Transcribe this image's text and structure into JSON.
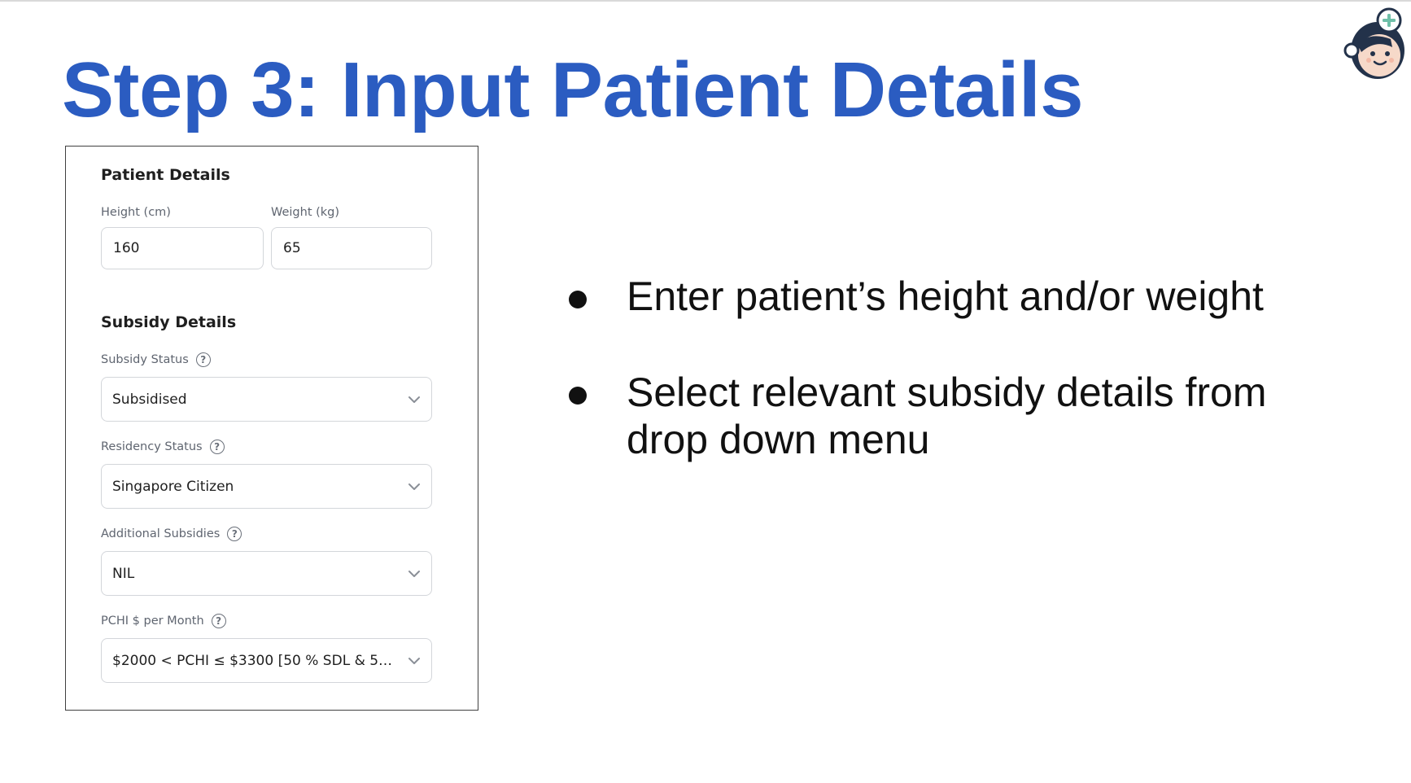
{
  "slide": {
    "title": "Step 3: Input Patient Details"
  },
  "form": {
    "patient_section_title": "Patient Details",
    "height": {
      "label": "Height (cm)",
      "value": "160"
    },
    "weight": {
      "label": "Weight (kg)",
      "value": "65"
    },
    "subsidy_section_title": "Subsidy Details",
    "subsidy_status": {
      "label": "Subsidy Status",
      "value": "Subsidised"
    },
    "residency_status": {
      "label": "Residency Status",
      "value": "Singapore Citizen"
    },
    "additional_subsidies": {
      "label": "Additional Subsidies",
      "value": "NIL"
    },
    "pchi": {
      "label": "PCHI $ per Month",
      "value": "$2000 < PCHI ≤ $3300 [50 % SDL & 50%..."
    },
    "help_glyph": "?"
  },
  "bullets": [
    "Enter patient’s height and/or weight",
    "Select relevant subsidy details from drop down menu"
  ],
  "colors": {
    "title": "#2b5cc1",
    "mascot_accent": "#6fbfa8",
    "mascot_hair": "#23324a",
    "mascot_skin": "#f6d9c9"
  },
  "icons": {
    "mascot": "doctor-mascot-icon",
    "help": "question-circle-icon",
    "dropdown": "chevron-down-icon"
  }
}
